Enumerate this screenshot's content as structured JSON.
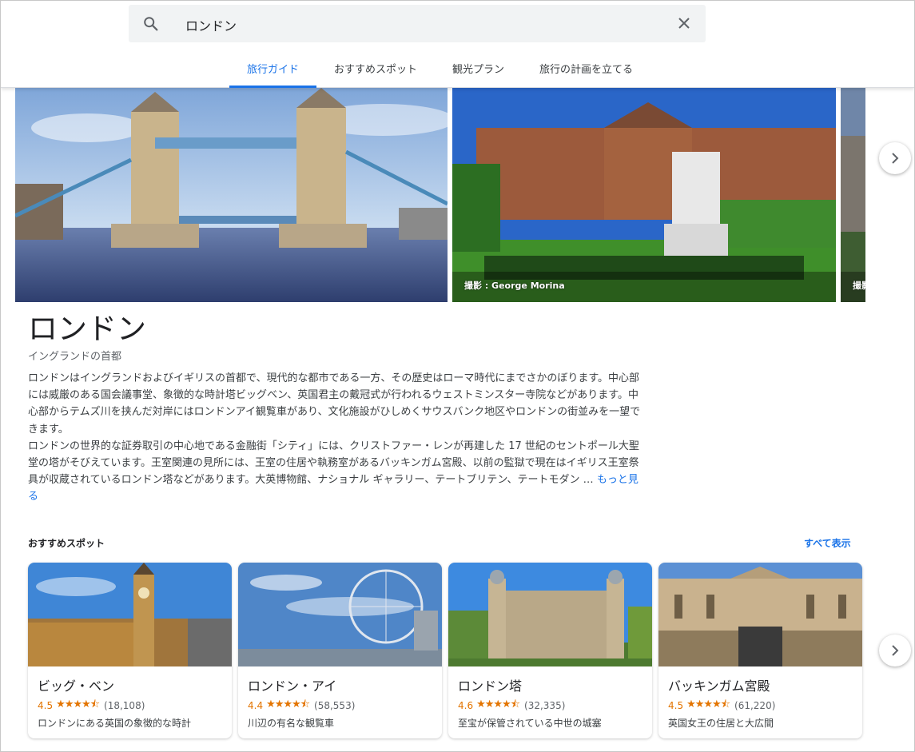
{
  "search": {
    "query": "ロンドン"
  },
  "tabs": [
    {
      "label": "旅行ガイド"
    },
    {
      "label": "おすすめスポット"
    },
    {
      "label": "観光プラン"
    },
    {
      "label": "旅行の計画を立てる"
    }
  ],
  "gallery": {
    "photo2_credit": "撮影 : George Morina",
    "photo3_credit": "撮影"
  },
  "place": {
    "title": "ロンドン",
    "subtitle": "イングランドの首都",
    "paragraph1": "ロンドンはイングランドおよびイギリスの首都で、現代的な都市である一方、その歴史はローマ時代にまでさかのぼります。中心部には威厳のある国会議事堂、象徴的な時計塔ビッグベン、英国君主の戴冠式が行われるウェストミンスター寺院などがあります。中心部からテムズ川を挟んだ対岸にはロンドンアイ観覧車があり、文化施設がひしめくサウスバンク地区やロンドンの街並みを一望できます。",
    "paragraph2": "ロンドンの世界的な証券取引の中心地である金融街「シティ」には、クリストファー・レンが再建した 17 世紀のセントポール大聖堂の塔がそびえています。王室関連の見所には、王室の住居や執務室があるバッキンガム宮殿、以前の監獄で現在はイギリス王室祭具が収蔵されているロンドン塔などがあります。大英博物館、ナショナル ギャラリー、テートブリテン、テートモダン … ",
    "more_link": "もっと見る"
  },
  "spots": {
    "heading": "おすすめスポット",
    "see_all": "すべて表示",
    "items": [
      {
        "name": "ビッグ・ベン",
        "score": "4.5",
        "stars": "★★★★⯪",
        "count": "(18,108)",
        "desc": "ロンドンにある英国の象徴的な時計"
      },
      {
        "name": "ロンドン・アイ",
        "score": "4.4",
        "stars": "★★★★⯪",
        "count": "(58,553)",
        "desc": "川辺の有名な観覧車"
      },
      {
        "name": "ロンドン塔",
        "score": "4.6",
        "stars": "★★★★⯪",
        "count": "(32,335)",
        "desc": "至宝が保管されている中世の城塞"
      },
      {
        "name": "バッキンガム宮殿",
        "score": "4.5",
        "stars": "★★★★⯪",
        "count": "(61,220)",
        "desc": "英国女王の住居と大広間"
      }
    ]
  },
  "colors": {
    "accent": "#1a73e8",
    "rating": "#e37400"
  }
}
